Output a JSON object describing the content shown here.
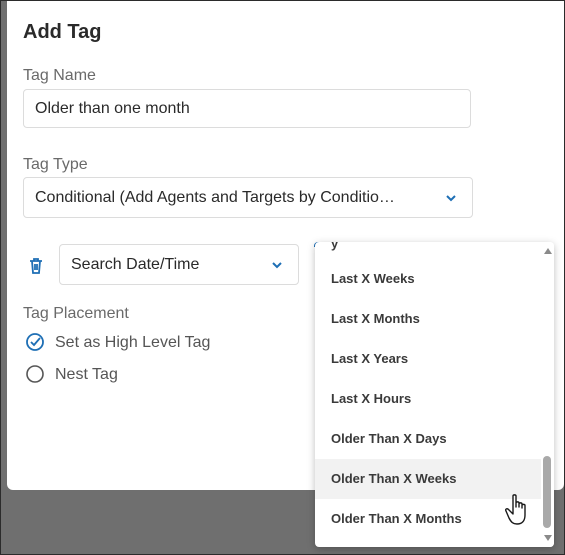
{
  "dialog": {
    "title": "Add Tag",
    "tag_name_label": "Tag Name",
    "tag_name_value": "Older than one month",
    "tag_type_label": "Tag Type",
    "tag_type_value": "Conditional (Add Agents and Targets by Conditio…",
    "condition_field_value": "Search Date/Time",
    "placement_label": "Tag Placement",
    "placement_options": [
      {
        "label": "Set as High Level Tag",
        "selected": true
      },
      {
        "label": "Nest Tag",
        "selected": false
      }
    ]
  },
  "dropdown": {
    "items": [
      "Last X Weeks",
      "Last X Months",
      "Last X Years",
      "Last X Hours",
      "Older Than X Days",
      "Older Than X Weeks",
      "Older Than X Months"
    ],
    "hovered_index": 5
  },
  "colors": {
    "accent": "#1e6fb5",
    "overlay": "#6f6f6f"
  },
  "icons": [
    "trash-icon",
    "chevron-down-icon",
    "check-circle-icon",
    "radio-empty-icon",
    "hand-cursor-icon"
  ]
}
